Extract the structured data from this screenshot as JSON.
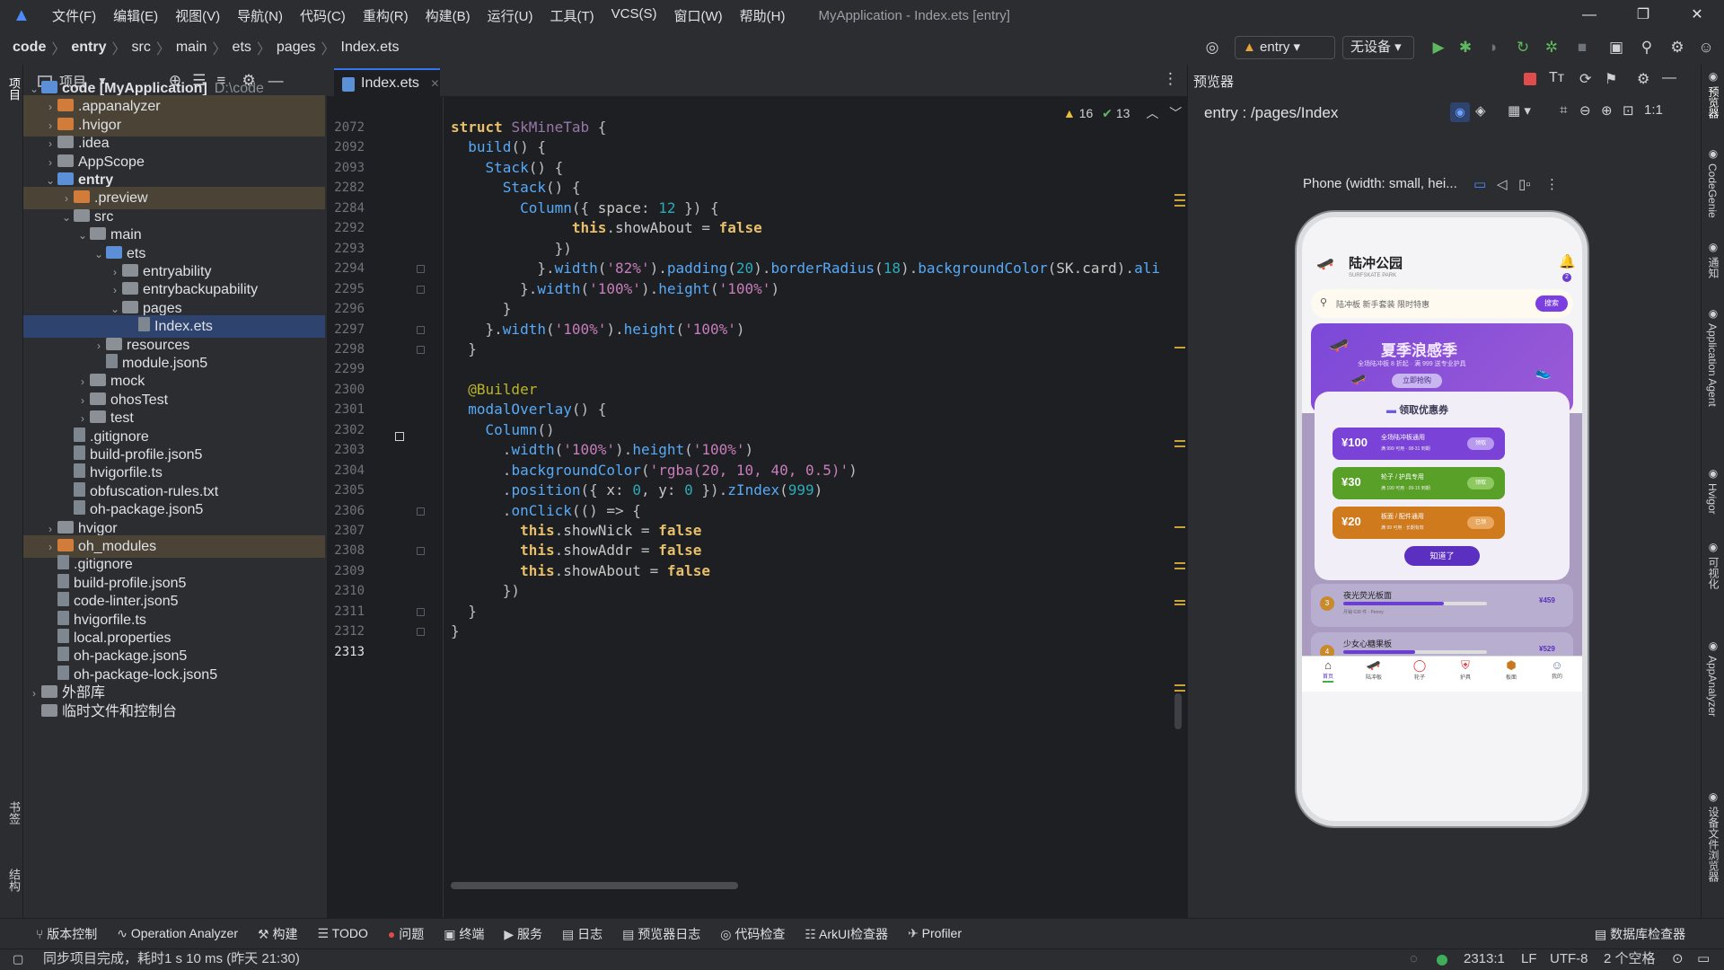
{
  "menu": {
    "items": [
      "文件(F)",
      "编辑(E)",
      "视图(V)",
      "导航(N)",
      "代码(C)",
      "重构(R)",
      "构建(B)",
      "运行(U)",
      "工具(T)",
      "VCS(S)",
      "窗口(W)",
      "帮助(H)"
    ],
    "title": "MyApplication - Index.ets [entry]"
  },
  "breadcrumb": [
    "code",
    "entry",
    "src",
    "main",
    "ets",
    "pages",
    "Index.ets"
  ],
  "toolbar": {
    "module": "entry",
    "device": "无设备"
  },
  "project_panel": {
    "title": "项目",
    "rows": [
      {
        "label": "code [MyApplication]",
        "extra": "D:\\code",
        "depth": 0,
        "arrow": "▾",
        "icon": "bfold",
        "bold": true
      },
      {
        "label": ".appanalyzer",
        "depth": 1,
        "arrow": "▸",
        "icon": "ofold",
        "hl": true
      },
      {
        "label": ".hvigor",
        "depth": 1,
        "arrow": "▸",
        "icon": "ofold",
        "hl": true
      },
      {
        "label": ".idea",
        "depth": 1,
        "arrow": "▸",
        "icon": "fold"
      },
      {
        "label": "AppScope",
        "depth": 1,
        "arrow": "▸",
        "icon": "fold"
      },
      {
        "label": "entry",
        "depth": 1,
        "arrow": "▾",
        "icon": "bfold",
        "bold": true
      },
      {
        "label": ".preview",
        "depth": 2,
        "arrow": "▸",
        "icon": "ofold",
        "hl": true
      },
      {
        "label": "src",
        "depth": 2,
        "arrow": "▾",
        "icon": "fold"
      },
      {
        "label": "main",
        "depth": 3,
        "arrow": "▾",
        "icon": "fold"
      },
      {
        "label": "ets",
        "depth": 4,
        "arrow": "▾",
        "icon": "bfold"
      },
      {
        "label": "entryability",
        "depth": 5,
        "arrow": "▸",
        "icon": "fold"
      },
      {
        "label": "entrybackupability",
        "depth": 5,
        "arrow": "▸",
        "icon": "fold"
      },
      {
        "label": "pages",
        "depth": 5,
        "arrow": "▾",
        "icon": "fold"
      },
      {
        "label": "Index.ets",
        "depth": 6,
        "arrow": "",
        "icon": "file",
        "sel": true
      },
      {
        "label": "resources",
        "depth": 4,
        "arrow": "▸",
        "icon": "fold"
      },
      {
        "label": "module.json5",
        "depth": 4,
        "arrow": "",
        "icon": "file"
      },
      {
        "label": "mock",
        "depth": 3,
        "arrow": "▸",
        "icon": "fold"
      },
      {
        "label": "ohosTest",
        "depth": 3,
        "arrow": "▸",
        "icon": "fold"
      },
      {
        "label": "test",
        "depth": 3,
        "arrow": "▸",
        "icon": "fold"
      },
      {
        "label": ".gitignore",
        "depth": 2,
        "arrow": "",
        "icon": "file"
      },
      {
        "label": "build-profile.json5",
        "depth": 2,
        "arrow": "",
        "icon": "file"
      },
      {
        "label": "hvigorfile.ts",
        "depth": 2,
        "arrow": "",
        "icon": "file"
      },
      {
        "label": "obfuscation-rules.txt",
        "depth": 2,
        "arrow": "",
        "icon": "file"
      },
      {
        "label": "oh-package.json5",
        "depth": 2,
        "arrow": "",
        "icon": "file"
      },
      {
        "label": "hvigor",
        "depth": 1,
        "arrow": "▸",
        "icon": "fold"
      },
      {
        "label": "oh_modules",
        "depth": 1,
        "arrow": "▸",
        "icon": "ofold",
        "hl": true
      },
      {
        "label": ".gitignore",
        "depth": 1,
        "arrow": "",
        "icon": "file"
      },
      {
        "label": "build-profile.json5",
        "depth": 1,
        "arrow": "",
        "icon": "file"
      },
      {
        "label": "code-linter.json5",
        "depth": 1,
        "arrow": "",
        "icon": "file"
      },
      {
        "label": "hvigorfile.ts",
        "depth": 1,
        "arrow": "",
        "icon": "file"
      },
      {
        "label": "local.properties",
        "depth": 1,
        "arrow": "",
        "icon": "file"
      },
      {
        "label": "oh-package.json5",
        "depth": 1,
        "arrow": "",
        "icon": "file"
      },
      {
        "label": "oh-package-lock.json5",
        "depth": 1,
        "arrow": "",
        "icon": "file"
      },
      {
        "label": "外部库",
        "depth": 0,
        "arrow": "▸",
        "icon": "fold"
      },
      {
        "label": "临时文件和控制台",
        "depth": 0,
        "arrow": "",
        "icon": "fold"
      }
    ]
  },
  "editor": {
    "tab": "Index.ets",
    "inspections": {
      "warnings": "16",
      "weak": "13"
    },
    "lines": [
      {
        "n": "2072",
        "html": "<span class='kw'>struct</span> <span class='tp'>SkMineTab</span> {"
      },
      {
        "n": "2092",
        "html": "  <span class='fn'>build</span>() {"
      },
      {
        "n": "2093",
        "html": "    <span class='fn'>Stack</span>() {"
      },
      {
        "n": "2282",
        "html": "      <span class='fn'>Stack</span>() {"
      },
      {
        "n": "2284",
        "html": "        <span class='fn'>Column</span>({ <span class='pr'>space</span>: <span class='nm'>12</span> }) {"
      },
      {
        "n": "2292",
        "html": "              <span class='kw'>this</span>.<span class='pr'>showAbout</span> = <span class='kw'>false</span>"
      },
      {
        "n": "2293",
        "html": "            })"
      },
      {
        "n": "2294",
        "html": "          }.<span class='fn'>width</span>(<span class='st'>'82%'</span>).<span class='fn'>padding</span>(<span class='nm'>20</span>).<span class='fn'>borderRadius</span>(<span class='nm'>18</span>).<span class='fn'>backgroundColor</span>(<span class='pr'>SK</span>.<span class='pr'>card</span>).<span class='fn'>ali</span>"
      },
      {
        "n": "2295",
        "html": "        }.<span class='fn'>width</span>(<span class='st'>'100%'</span>).<span class='fn'>height</span>(<span class='st'>'100%'</span>)"
      },
      {
        "n": "2296",
        "html": "      }"
      },
      {
        "n": "2297",
        "html": "    }.<span class='fn'>width</span>(<span class='st'>'100%'</span>).<span class='fn'>height</span>(<span class='st'>'100%'</span>)"
      },
      {
        "n": "2298",
        "html": "  }"
      },
      {
        "n": "2299",
        "html": ""
      },
      {
        "n": "2300",
        "html": "  <span class='an'>@Builder</span>"
      },
      {
        "n": "2301",
        "html": "  <span class='fn'>modalOverlay</span>() {"
      },
      {
        "n": "2302",
        "html": "    <span class='fn'>Column</span>()"
      },
      {
        "n": "2303",
        "html": "      .<span class='fn'>width</span>(<span class='st'>'100%'</span>).<span class='fn'>height</span>(<span class='st'>'100%'</span>)"
      },
      {
        "n": "2304",
        "html": "      .<span class='fn'>backgroundColor</span>(<span class='st'>'rgba(20, 10, 40, 0.5)'</span>)"
      },
      {
        "n": "2305",
        "html": "      .<span class='fn'>position</span>({ <span class='pr'>x</span>: <span class='nm'>0</span>, <span class='pr'>y</span>: <span class='nm'>0</span> }).<span class='fn'>zIndex</span>(<span class='nm'>999</span>)"
      },
      {
        "n": "2306",
        "html": "      .<span class='fn'>onClick</span>(() => {"
      },
      {
        "n": "2307",
        "html": "        <span class='kw'>this</span>.<span class='pr'>showNick</span> = <span class='kw'>false</span>"
      },
      {
        "n": "2308",
        "html": "        <span class='kw'>this</span>.<span class='pr'>showAddr</span> = <span class='kw'>false</span>"
      },
      {
        "n": "2309",
        "html": "        <span class='kw'>this</span>.<span class='pr'>showAbout</span> = <span class='kw'>false</span>"
      },
      {
        "n": "2310",
        "html": "      })"
      },
      {
        "n": "2311",
        "html": "  }"
      },
      {
        "n": "2312",
        "html": "}"
      },
      {
        "n": "2313",
        "html": ""
      }
    ]
  },
  "previewer": {
    "title": "预览器",
    "route": "entry : /pages/Index",
    "device": "Phone (width: small, hei..."
  },
  "phone": {
    "app_title": "陆冲公园",
    "app_subtitle": "SURFSKATE PARK",
    "bell_badge": "2",
    "search_placeholder": "陆冲板 新手套装 限时特惠",
    "search_button": "搜索",
    "banner_title": "夏季浪感季",
    "banner_sub": "全场陆冲板 8 折起 · 满 999 送专业护具",
    "banner_button": "立即抢购",
    "coupon_title": "领取优惠券",
    "coupons": [
      {
        "amount": "¥100",
        "title": "全场陆冲板通用",
        "desc": "满 999 可用 · 08-31 到期",
        "btn": "领取",
        "color": "#7a42d6",
        "btncolor": "#b79af0"
      },
      {
        "amount": "¥30",
        "title": "轮子 / 护具专用",
        "desc": "满 199 可用 · 09-15 到期",
        "btn": "领取",
        "color": "#58a028",
        "btncolor": "#8dc860"
      },
      {
        "amount": "¥20",
        "title": "板面 / 配件通用",
        "desc": "满 99 可用 · 长期有效",
        "btn": "已领",
        "color": "#d07a1e",
        "btncolor": "#e8a860"
      }
    ],
    "dismiss": "知道了",
    "list": [
      {
        "rank": "3",
        "name": "夜光荧光板面",
        "meta": "月销 638 件 · Penny",
        "price": "¥459",
        "bar": 0.7
      },
      {
        "rank": "4",
        "name": "少女心糖果板",
        "meta": "",
        "price": "¥529",
        "bar": 0.5
      }
    ],
    "tabs": [
      "首页",
      "陆冲板",
      "轮子",
      "护具",
      "板面",
      "我的"
    ]
  },
  "right_strip": [
    "预览器",
    "CodeGenie",
    "通知",
    "Application Agent",
    "Hvigor",
    "可视化",
    "AppAnalyzer",
    "设备文件浏览器"
  ],
  "left_strip": [
    "项目",
    "书签",
    "结构"
  ],
  "bottom_tools": [
    "版本控制",
    "Operation Analyzer",
    "构建",
    "TODO",
    "问题",
    "终端",
    "服务",
    "日志",
    "预览器日志",
    "代码检查",
    "ArkUI检查器",
    "Profiler"
  ],
  "bottom_right": "数据库检查器",
  "status": {
    "message": "同步项目完成，耗时1 s 10 ms (昨天 21:30)",
    "pos": "2313:1",
    "eol": "LF",
    "enc": "UTF-8",
    "indent": "2 个空格"
  }
}
